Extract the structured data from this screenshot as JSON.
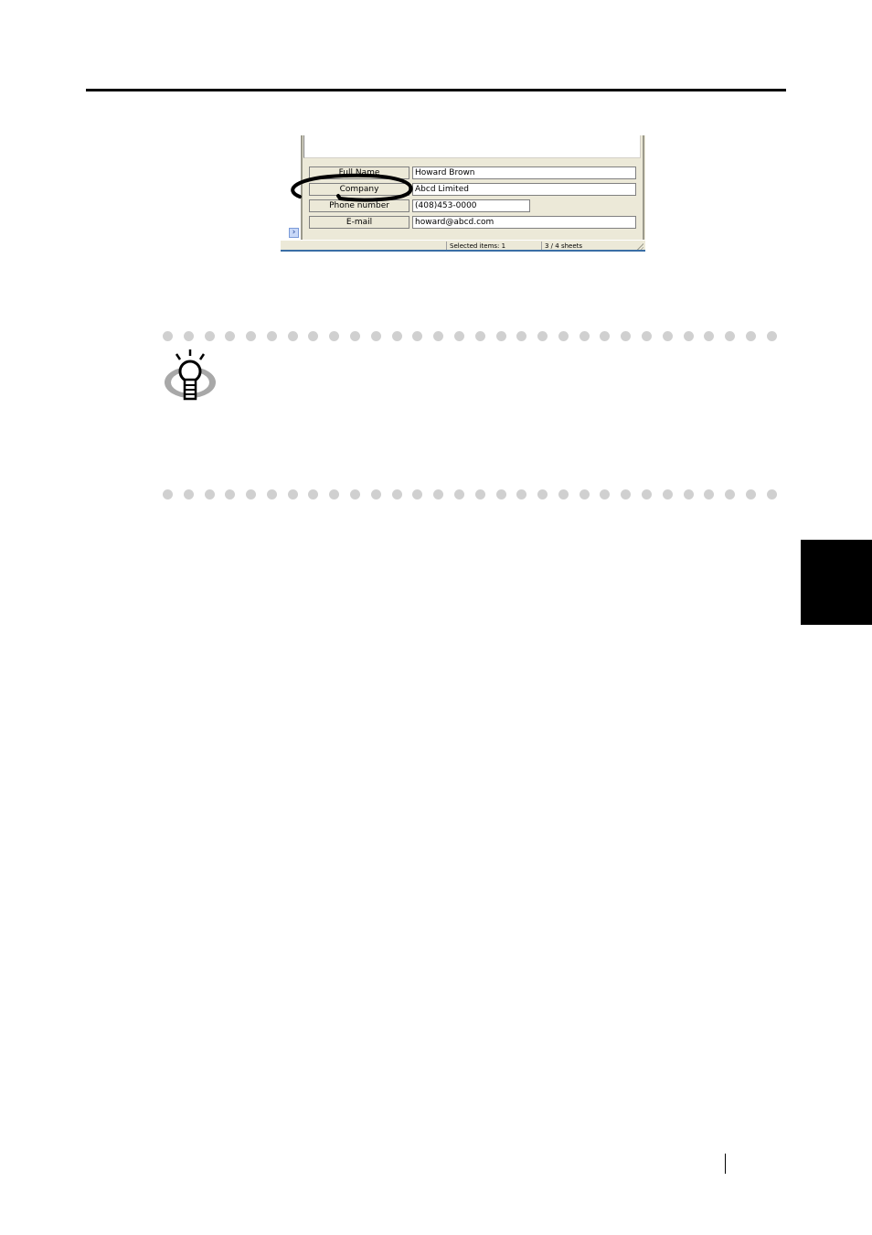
{
  "form": {
    "rows": [
      {
        "label": "Full Name",
        "value": "Howard Brown"
      },
      {
        "label": "Company",
        "value": "Abcd Limited"
      },
      {
        "label": "Phone number",
        "value": "(408)453-0000"
      },
      {
        "label": "E-mail",
        "value": "howard@abcd.com"
      }
    ]
  },
  "statusbar": {
    "selected_items": "Selected items:   1",
    "sheets": "3 /    4 sheets"
  },
  "icons": {
    "hint": "lightbulb-icon",
    "scroll": "chevron-right-icon"
  },
  "colors": {
    "dialog_bg": "#ece9d8",
    "dots": "#d0d0d0",
    "side_tab": "#000000"
  }
}
